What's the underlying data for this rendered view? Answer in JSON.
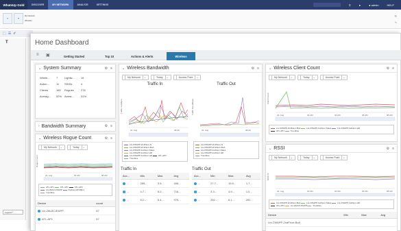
{
  "app": {
    "brand": "WhatsUp Gold"
  },
  "topnav": {
    "items": [
      "DISCOVER",
      "MY NETWORK",
      "ANALYZE",
      "SETTINGS"
    ],
    "user": "admin",
    "help": "HELP"
  },
  "ribbon": {
    "list": [
      "My Network",
      "Wireless"
    ]
  },
  "lefttool": {
    "t": "T",
    "legend": "Legend"
  },
  "dashboard": {
    "title": "Home Dashboard",
    "tabs": [
      "Getting Started",
      "Top 10",
      "Actions & Alerts",
      "Wireless"
    ],
    "active_tab": "Wireless"
  },
  "filters": {
    "network": "My Network",
    "today": "Today",
    "ap": "Access Point"
  },
  "system_summary": {
    "title": "System Summary",
    "rows": [
      [
        "Wirele...",
        "7",
        "Lightw...",
        "16"
      ],
      [
        "Auton...",
        "11",
        "SSIDs",
        "4"
      ],
      [
        "Clients",
        "160",
        "Rogues",
        "276"
      ],
      [
        "Averag...",
        "52%",
        "Avera...",
        "31%"
      ]
    ]
  },
  "bandwidth_summary": {
    "title": "Bandwidth Summary"
  },
  "rogue_count": {
    "title": "Wireless Rogue Count",
    "ylabel": "Rogue Count",
    "xticks": [
      "22. Aug",
      "04 AM",
      "08 AM"
    ],
    "legend": [
      "ATL-AP1",
      "ATL-AP1",
      "ATL-AP3",
      "Lts 26AU3-WAPP",
      "Durban 22CRM-1",
      "Trendline"
    ],
    "table_headers": [
      "Device",
      "count"
    ],
    "table_rows": [
      [
        "Ltx-26U3CJEAPP",
        "67"
      ],
      [
        "ATL-AP1",
        "67"
      ]
    ]
  },
  "wireless_bandwidth": {
    "title": "Wireless Bandwidth",
    "in_title": "Traffic In",
    "out_title": "Traffic Out",
    "ylabel_in": "Traffic In (Mbps)",
    "ylabel_out": "Traffic Out (Mbps)",
    "xticks": [
      "22. Aug",
      "06:00"
    ],
    "legend_in": [
      "Lts-CWAPP-2ndFloor-N",
      "Lts-CWAPP-2ndFloor-BoA",
      "Lts-CWAPP-1stFloor-Sales",
      "Lts-CWAPP-1stFloor-HR",
      "Lts-CWAPP-1stFloor-HR",
      "ATL-AP1",
      "Trendline"
    ],
    "legend_out": [
      "Lts-CWAPP-2ndFloor-N",
      "Lts-CWAPP-2ndFloor-BoA",
      "Lts-CWAPP-1stFloor-Sales",
      "Lts-CWAPP-1stFloor-HR",
      "Trendline"
    ],
    "table_in_title": "Traffic In",
    "table_out_title": "Traffic Out",
    "table_headers": [
      "Acc...",
      "Min",
      "Max",
      "Avg"
    ],
    "table_in_rows": [
      [
        "...",
        "289...",
        "3.5...",
        "455..."
      ],
      [
        "...",
        "4.7...",
        "6.2...",
        "716..."
      ],
      [
        "...",
        "5.2...",
        "5.4...",
        "976..."
      ]
    ],
    "table_out_rows": [
      [
        "...",
        "27.7...",
        "19.5...",
        "1.7..."
      ],
      [
        "...",
        "3.3...",
        "4.9...",
        "1.0..."
      ],
      [
        "...",
        "282...",
        "6.1...",
        "292..."
      ]
    ]
  },
  "client_count": {
    "title": "Wireless Client Count",
    "ylabel": "Client Count",
    "xticks": [
      "22. Aug",
      "02 AM",
      "04 AM",
      "06 AM",
      "08 AM"
    ],
    "legend": [
      "Lts-CWAPP-2ndFloor-BoA",
      "Lts-CWAPP-1stFloor-Sales",
      "Lts-CWAPP-1stFloor-HR",
      "ATL-AP1",
      "Trendline"
    ]
  },
  "rssi": {
    "title": "RSSI",
    "ylabel": "RSSI %",
    "xticks": [
      "22. Aug",
      "02 AM",
      "04 AM",
      "06 AM",
      "08 AM"
    ],
    "legend": [
      "Lts-CWAPP-2ndFloor-BoA",
      "Lts-CWAPP-1stFloor-Sales",
      "Lts-CWAPP-1stFloor-HR",
      "ATL-AP1",
      "Lts-26AU3-WAPP",
      "Trendline"
    ],
    "table_headers": [
      "Device",
      "Min",
      "Max",
      "Avg"
    ],
    "table_rows": [
      [
        "Ltx-CWAPP-2ndFloor-BoA",
        "",
        "",
        ""
      ]
    ]
  }
}
